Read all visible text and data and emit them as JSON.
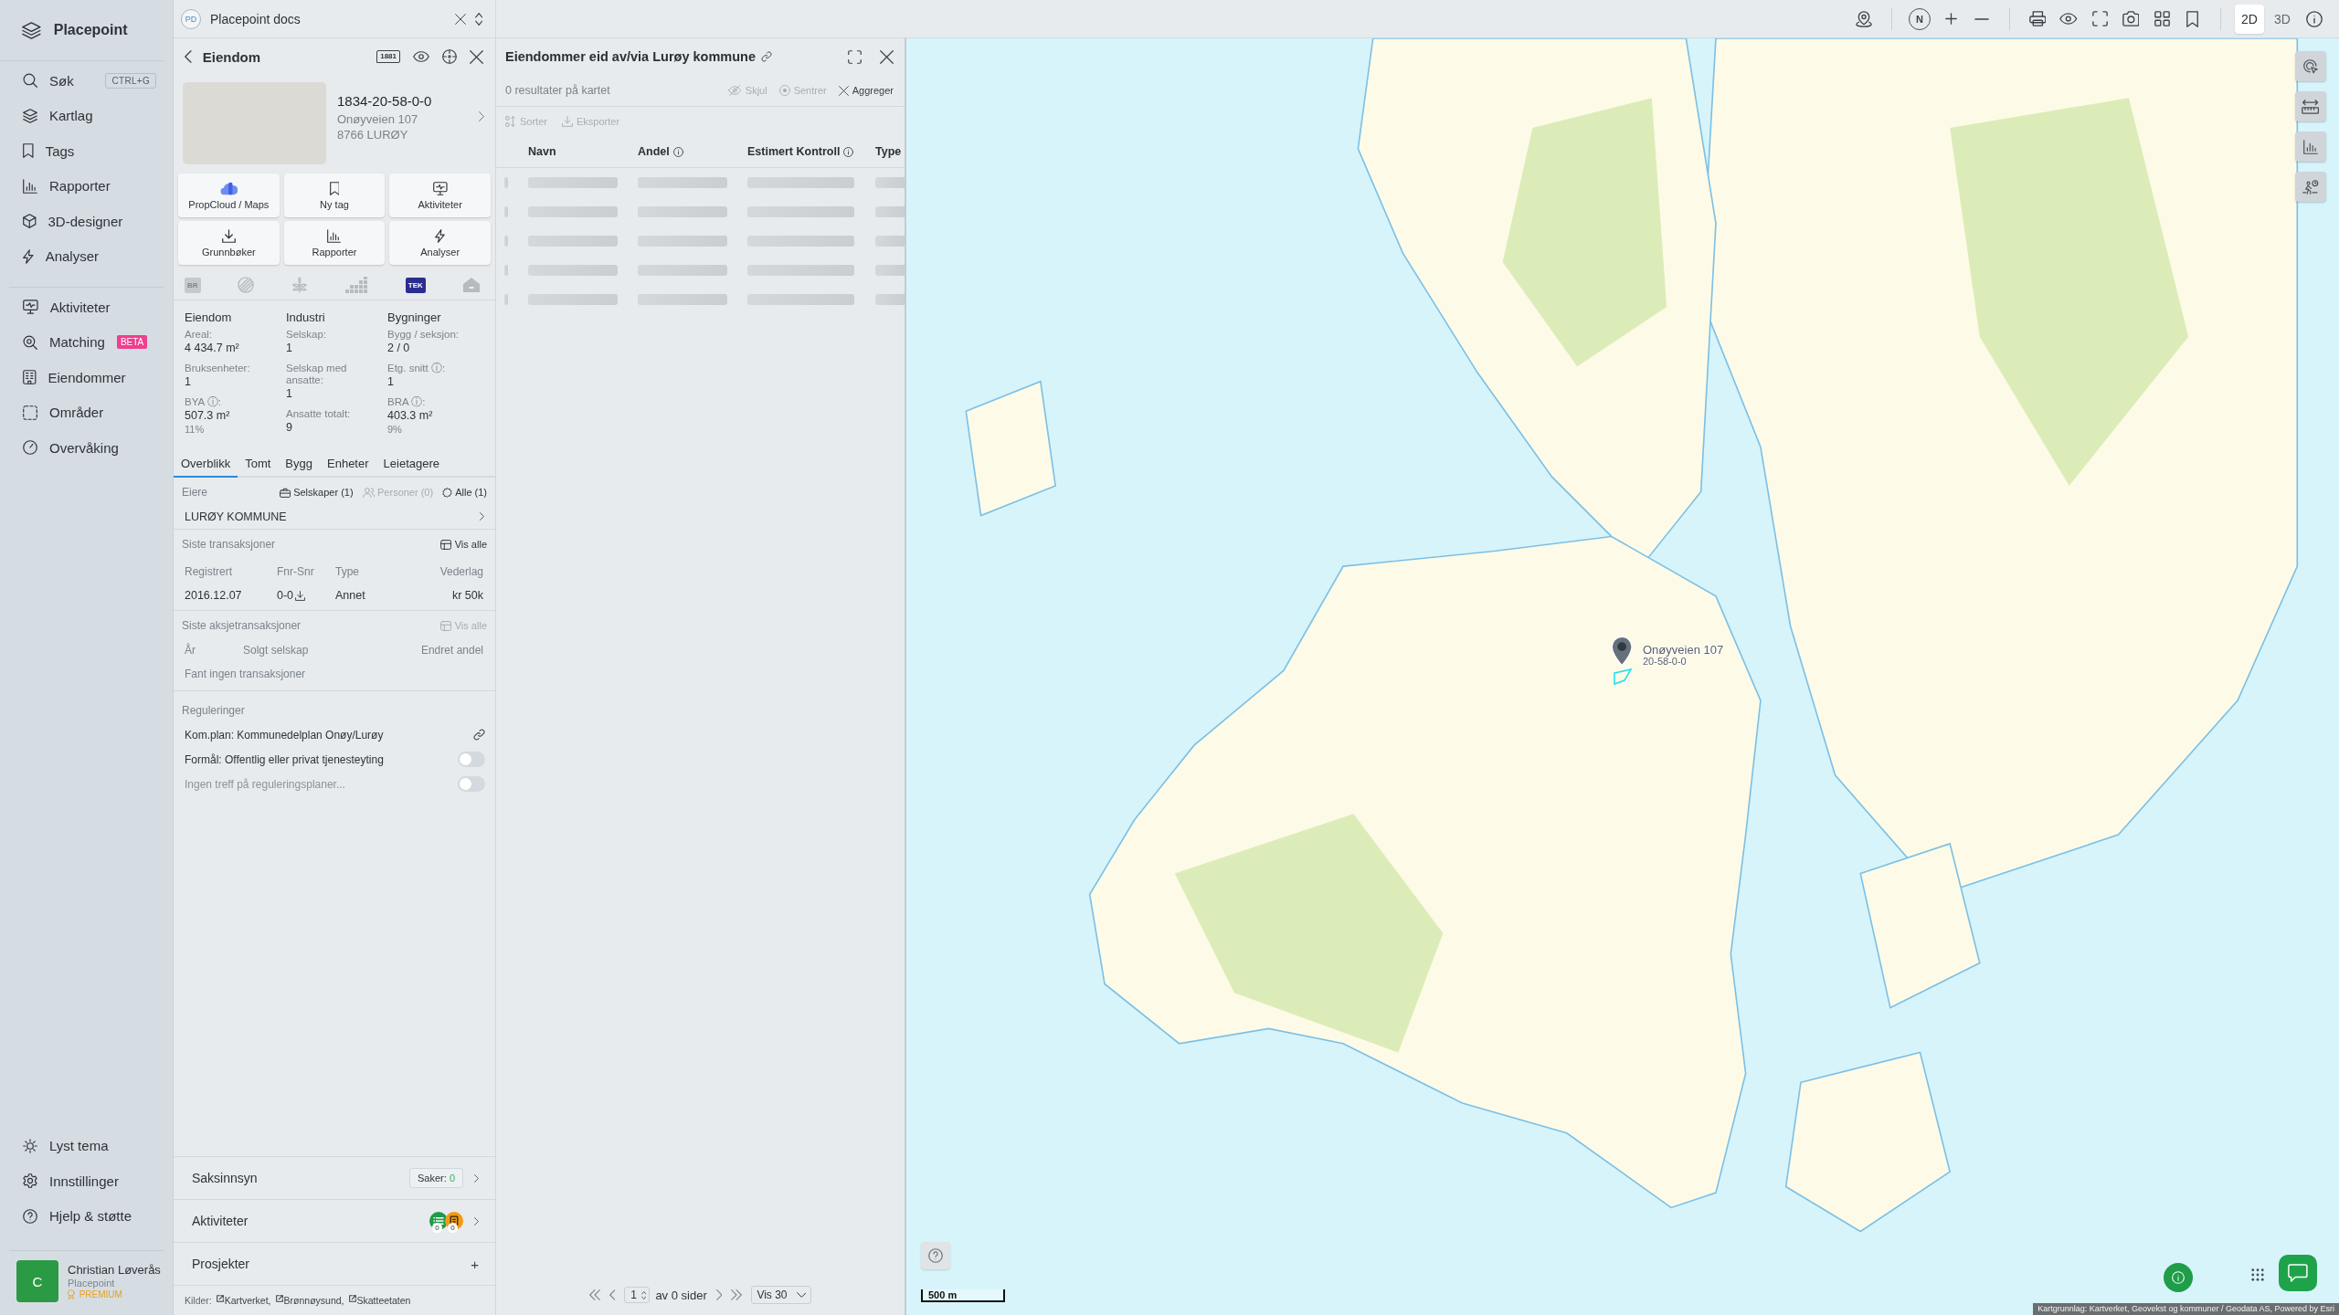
{
  "sidebar": {
    "brand": "Placepoint",
    "nav_primary": [
      {
        "label": "Søk",
        "shortcut": "CTRL+G"
      },
      {
        "label": "Kartlag"
      },
      {
        "label": "Tags"
      },
      {
        "label": "Rapporter"
      },
      {
        "label": "3D-designer"
      },
      {
        "label": "Analyser"
      }
    ],
    "nav_secondary": [
      {
        "label": "Aktiviteter"
      },
      {
        "label": "Matching",
        "badge": "BETA"
      },
      {
        "label": "Eiendommer"
      },
      {
        "label": "Områder"
      },
      {
        "label": "Overvåking"
      }
    ],
    "nav_footer": [
      {
        "label": "Lyst tema"
      },
      {
        "label": "Innstillinger"
      },
      {
        "label": "Hjelp & støtte"
      }
    ],
    "user": {
      "initial": "C",
      "name": "Christian Løverås",
      "org": "Placepoint",
      "plan": "PREMIUM"
    }
  },
  "workspace": {
    "initials": "PD",
    "name": "Placepoint docs"
  },
  "property_panel": {
    "title": "Eiendom",
    "directory_badge": "1881",
    "property": {
      "id": "1834-20-58-0-0",
      "address": "Onøyveien 107",
      "postal": "8766 LURØY"
    },
    "actions": [
      {
        "label": "PropCloud / Maps"
      },
      {
        "label": "Ny tag"
      },
      {
        "label": "Aktiviteter"
      },
      {
        "label": "Grunnbøker"
      },
      {
        "label": "Rapporter"
      },
      {
        "label": "Analyser"
      }
    ],
    "sources": [
      {
        "text": "BR",
        "active": false
      },
      {
        "active": false
      },
      {
        "active": false
      },
      {
        "active": false
      },
      {
        "text": "TEK",
        "active": true
      },
      {
        "active": false
      }
    ],
    "stats": [
      {
        "heading": "Eiendom",
        "items": [
          {
            "label": "Areal:",
            "value": "4 434.7 m²"
          },
          {
            "label": "Bruksenheter:",
            "value": "1"
          },
          {
            "label": "BYA ⓘ:",
            "value": "507.3 m²",
            "share": "11%"
          }
        ]
      },
      {
        "heading": "Industri",
        "items": [
          {
            "label": "Selskap:",
            "value": "1"
          },
          {
            "label": "Selskap med ansatte:",
            "value": "1"
          },
          {
            "label": "Ansatte totalt:",
            "value": "9"
          }
        ]
      },
      {
        "heading": "Bygninger",
        "items": [
          {
            "label": "Bygg / seksjon:",
            "value": "2 / 0"
          },
          {
            "label": "Etg. snitt ⓘ:",
            "value": "1"
          },
          {
            "label": "BRA ⓘ:",
            "value": "403.3 m²",
            "share": "9%"
          }
        ]
      }
    ],
    "tabs": [
      {
        "label": "Overblikk",
        "selected": true
      },
      {
        "label": "Tomt",
        "selected": false
      },
      {
        "label": "Bygg",
        "selected": false
      },
      {
        "label": "Enheter",
        "selected": false
      },
      {
        "label": "Leietagere",
        "selected": false
      }
    ],
    "owners": {
      "label": "Eiere",
      "filters": [
        {
          "label": "Selskaper (1)",
          "disabled": false
        },
        {
          "label": "Personer (0)",
          "disabled": true
        },
        {
          "label": "Alle (1)",
          "disabled": false
        }
      ],
      "rows": [
        "LURØY KOMMUNE"
      ]
    },
    "transactions": {
      "label": "Siste transaksjoner",
      "view_all": {
        "label": "Vis alle",
        "disabled": false
      },
      "columns": [
        "Registrert",
        "Fnr-Snr",
        "Type",
        "Vederlag"
      ],
      "rows": [
        [
          "2016.12.07",
          "0-0",
          "Annet",
          "kr 50k"
        ]
      ]
    },
    "share_transactions": {
      "label": "Siste aksjetransaksjoner",
      "view_all": {
        "label": "Vis alle",
        "disabled": true
      },
      "columns": [
        "År",
        "Solgt selskap",
        "Endret andel"
      ],
      "empty": "Fant ingen transaksjoner"
    },
    "regulations": {
      "label": "Reguleringer",
      "items": [
        {
          "kind": "link",
          "text": "Kom.plan: Kommunedelplan Onøy/Lurøy"
        },
        {
          "kind": "toggle",
          "text": "Formål: Offentlig eller privat tjenesteyting",
          "on": false,
          "disabled": false
        },
        {
          "kind": "toggle",
          "text": "Ingen treff på reguleringsplaner...",
          "on": false,
          "disabled": true
        }
      ]
    },
    "sections": [
      {
        "kind": "count",
        "title": "Saksinnsyn",
        "count_label": "Saker:",
        "count": "0"
      },
      {
        "kind": "activity",
        "title": "Aktiviteter",
        "counters": [
          {
            "count": "0",
            "color": "#1e9b48"
          },
          {
            "count": "0",
            "color": "#f39a12"
          }
        ]
      },
      {
        "kind": "add",
        "title": "Prosjekter",
        "action": "+"
      }
    ],
    "sources_footer": {
      "label": "Kilder:",
      "links": [
        "Kartverket,",
        "Brønnøysund,",
        "Skatteetaten"
      ]
    }
  },
  "results_panel": {
    "title": "Eiendommer eid av/via Lurøy kommune",
    "summary": "0 resultater på kartet",
    "actions": [
      {
        "label": "Skjul",
        "disabled": true
      },
      {
        "label": "Sentrer",
        "disabled": true
      },
      {
        "label": "Aggreger",
        "disabled": false
      }
    ],
    "tools": [
      {
        "label": "Sorter",
        "disabled": true
      },
      {
        "label": "Eksporter",
        "disabled": true
      }
    ],
    "columns": [
      {
        "label": "Navn",
        "info": false
      },
      {
        "label": "Andel",
        "info": true
      },
      {
        "label": "Estimert Kontroll",
        "info": true
      },
      {
        "label": "Type",
        "info": false
      }
    ],
    "loading": true,
    "pagination": {
      "page": "1",
      "pages_text": "av 0 sider",
      "page_size": "Vis 30"
    }
  },
  "map_toolbar": {
    "compass": "N",
    "view_modes": [
      {
        "label": "2D",
        "selected": true
      },
      {
        "label": "3D",
        "selected": false
      }
    ]
  },
  "map": {
    "marker": {
      "title": "Onøyveien 107",
      "subtitle": "20-58-0-0"
    },
    "scale": "500 m",
    "attribution": "Kartgrunnlag: Kartverket, Geovekst og kommuner / Geodata AS, Powered by Esri"
  }
}
